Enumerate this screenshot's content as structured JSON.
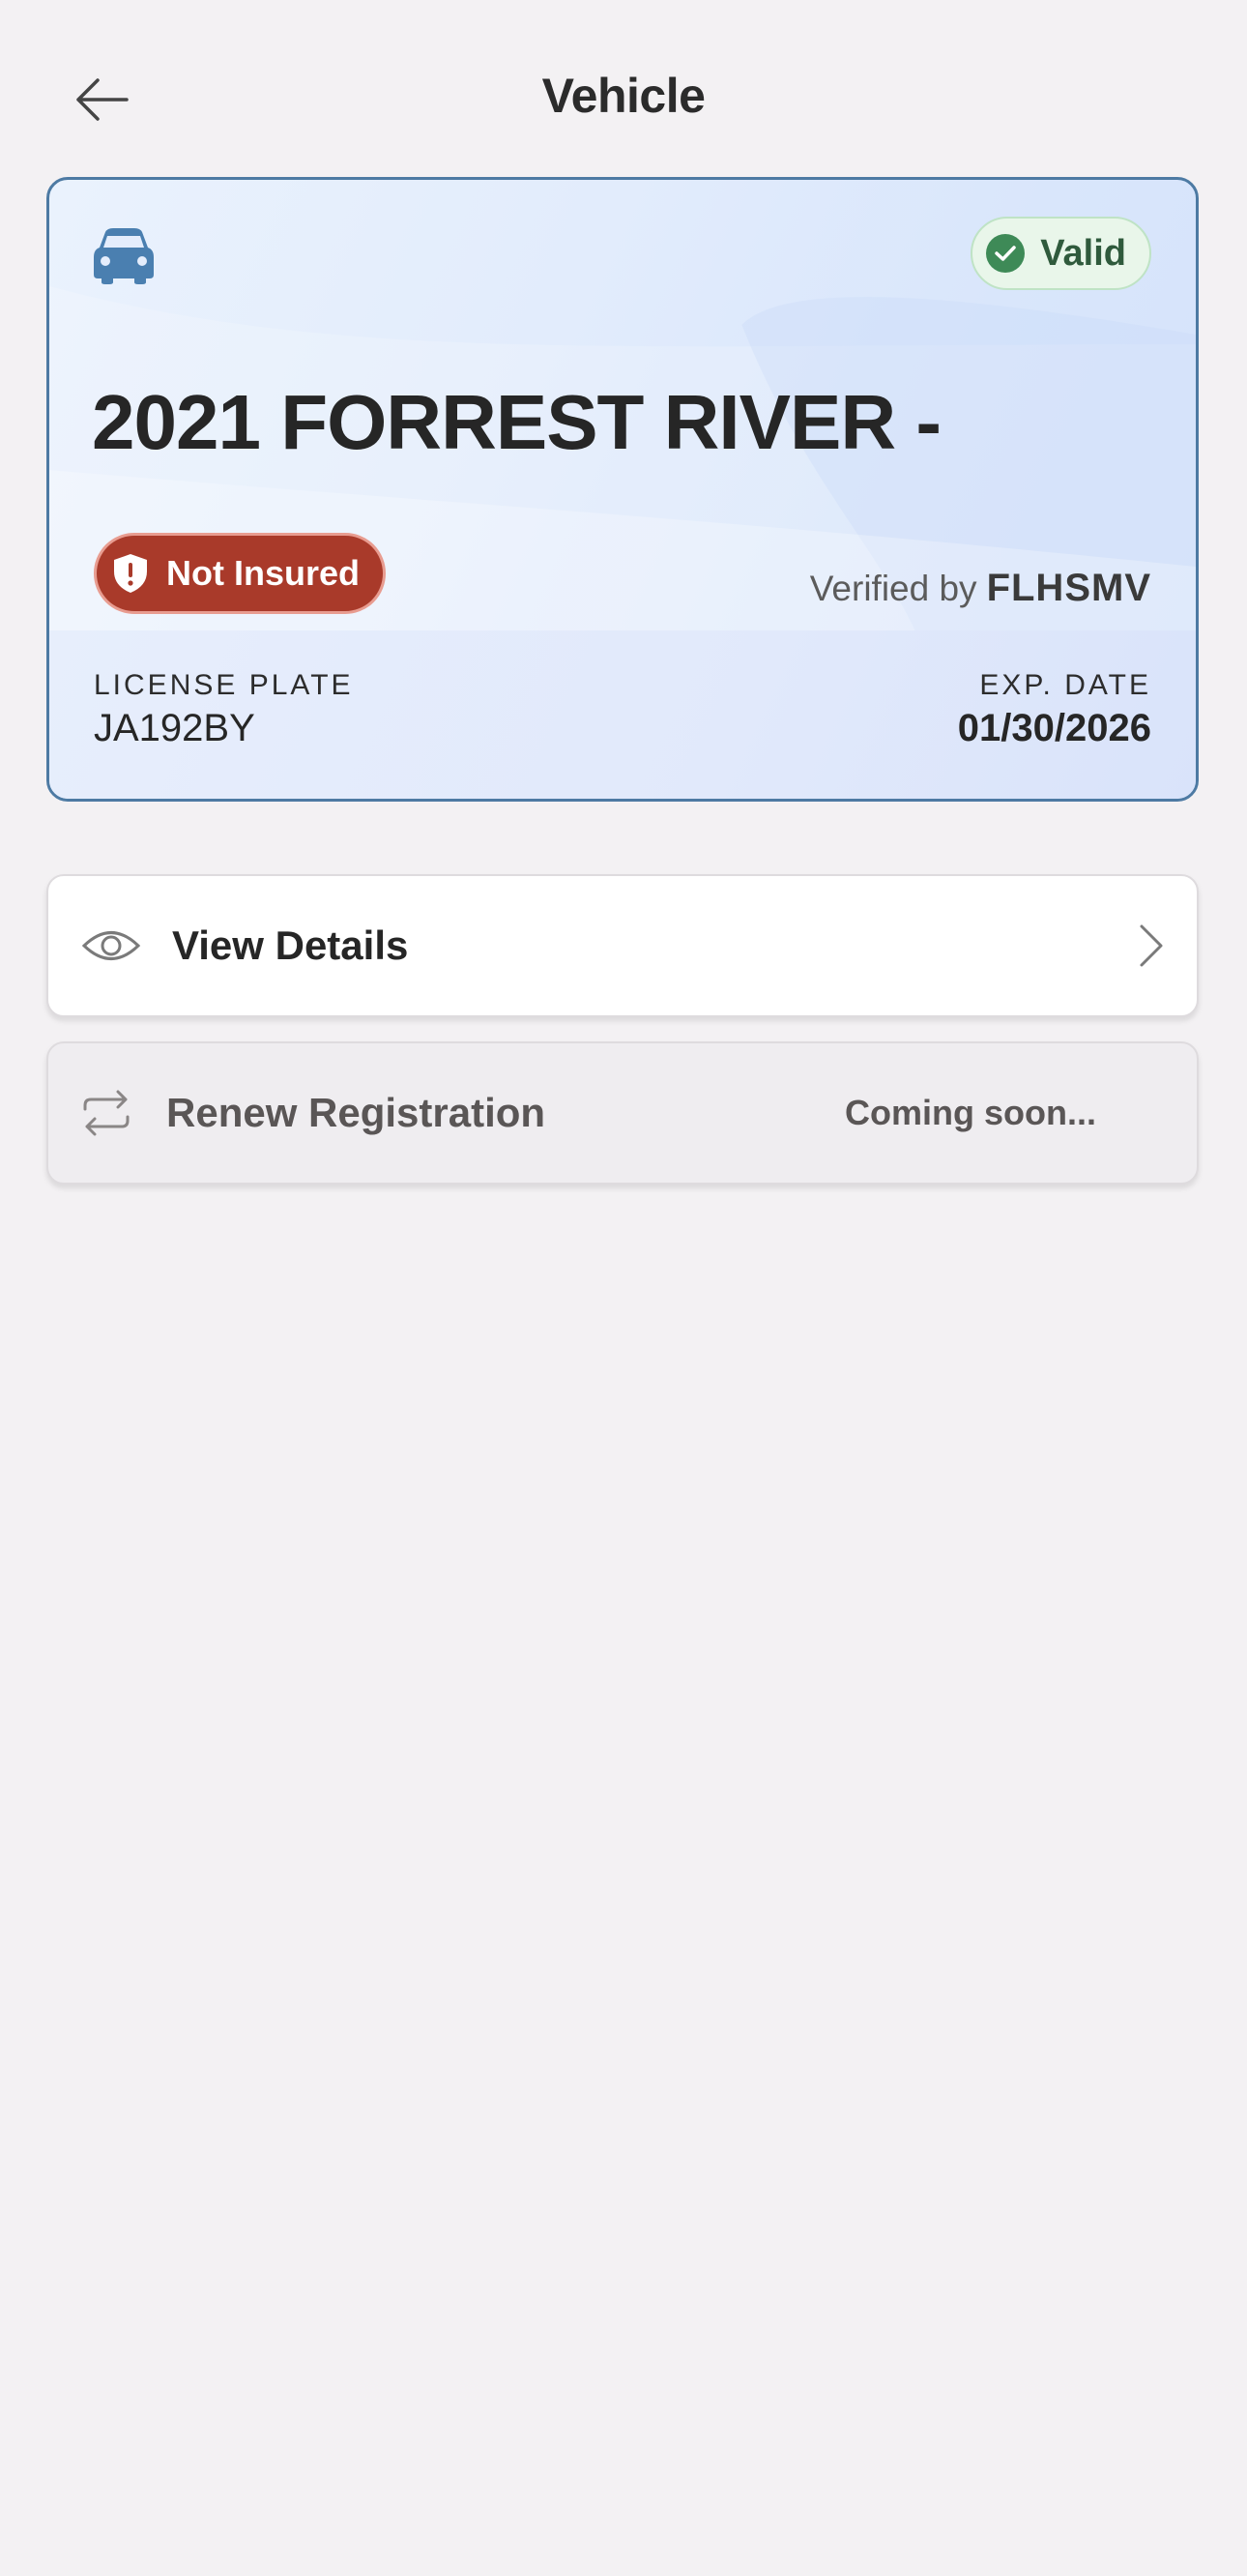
{
  "header": {
    "title": "Vehicle"
  },
  "vehicle_card": {
    "name": "2021 FORREST RIVER -",
    "status_badge": "Valid",
    "insurance_badge": "Not Insured",
    "verified_by_text": "Verified by",
    "verified_by_brand": "FLHSMV",
    "license_plate_label": "LICENSE PLATE",
    "license_plate_value": "JA192BY",
    "exp_date_label": "EXP. DATE",
    "exp_date_value": "01/30/2026"
  },
  "actions": {
    "view_details_label": "View Details",
    "renew_registration_label": "Renew Registration",
    "renew_status": "Coming soon..."
  },
  "colors": {
    "background": "#f3f1f3",
    "card_border": "#4d7aa3",
    "valid_green": "#3e8a57",
    "not_insured_red": "#a93a2a",
    "car_icon_blue": "#4a7fb0"
  },
  "icons": {
    "back": "arrow-left-icon",
    "car": "car-icon",
    "valid": "check-circle-icon",
    "insurance": "shield-alert-icon",
    "view": "eye-icon",
    "renew": "repeat-icon",
    "chevron": "chevron-right-icon"
  }
}
